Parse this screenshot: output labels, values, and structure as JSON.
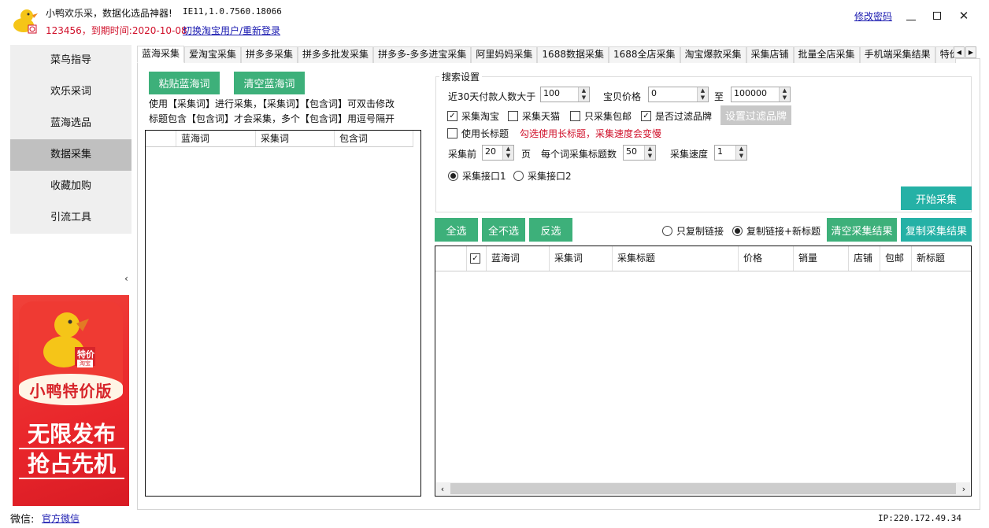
{
  "header": {
    "app_title": "小鸭欢乐采，数据化选品神器!",
    "version": "IE11,1.0.7560.18066",
    "user_info": "123456，到期时间:2020-10-08",
    "switch_user_link": "切换淘宝用户/重新登录",
    "change_password_link": "修改密码",
    "window_controls": {
      "minimize": "—",
      "maximize": "☐",
      "close": "✕"
    }
  },
  "sidebar": {
    "items": [
      {
        "label": "菜鸟指导",
        "active": false
      },
      {
        "label": "欢乐采词",
        "active": false
      },
      {
        "label": "蓝海选品",
        "active": false
      },
      {
        "label": "数据采集",
        "active": true
      },
      {
        "label": "收藏加购",
        "active": false
      },
      {
        "label": "引流工具",
        "active": false
      }
    ],
    "collapse_icon": "‹"
  },
  "banner": {
    "badge_top": "特价",
    "badge_bottom": "淘宝",
    "brand": "小鸭特价版",
    "slogan_line1": "无限发布",
    "slogan_line2": "抢占先机"
  },
  "footer": {
    "wechat_label": "微信:",
    "wechat_link": "官方微信",
    "ip": "IP:220.172.49.34"
  },
  "tabs": {
    "items": [
      "蓝海采集",
      "爱淘宝采集",
      "拼多多采集",
      "拼多多批发采集",
      "拼多多-多多进宝采集",
      "阿里妈妈采集",
      "1688数据采集",
      "1688全店采集",
      "淘宝爆款采集",
      "采集店铺",
      "批量全店采集",
      "手机端采集结果",
      "特价"
    ],
    "active_index": 0,
    "scroll_left": "◀",
    "scroll_right": "▶"
  },
  "left_panel": {
    "paste_button": "粘贴蓝海词",
    "clear_button": "清空蓝海词",
    "hint_line1": "使用【采集词】进行采集，【采集词】【包含词】可双击修改",
    "hint_line2": "标题包含【包含词】才会采集，多个【包含词】用逗号隔开",
    "grid_columns": [
      "",
      "蓝海词",
      "采集词",
      "包含词"
    ]
  },
  "search_settings": {
    "title": "搜索设置",
    "min_buyers_label": "近30天付款人数大于",
    "min_buyers_value": "100",
    "price_label": "宝贝价格",
    "price_min": "0",
    "price_to_label": "至",
    "price_max": "100000",
    "checkboxes": [
      {
        "label": "采集淘宝",
        "checked": true
      },
      {
        "label": "采集天猫",
        "checked": false
      },
      {
        "label": "只采集包邮",
        "checked": false
      },
      {
        "label": "是否过滤品牌",
        "checked": true
      }
    ],
    "filter_brand_button": "设置过滤品牌",
    "long_title": {
      "label": "使用长标题",
      "checked": false
    },
    "long_title_warning": "勾选使用长标题，采集速度会变慢",
    "pages_label": "采集前",
    "pages_value": "20",
    "pages_unit": "页",
    "titles_per_word_label": "每个词采集标题数",
    "titles_per_word_value": "50",
    "speed_label": "采集速度",
    "speed_value": "1",
    "interfaces": [
      {
        "label": "采集接口1",
        "selected": true
      },
      {
        "label": "采集接口2",
        "selected": false
      }
    ],
    "start_button": "开始采集"
  },
  "results": {
    "select_all": "全选",
    "select_none": "全不选",
    "invert": "反选",
    "copy_options": [
      {
        "label": "只复制链接",
        "selected": false
      },
      {
        "label": "复制链接+新标题",
        "selected": true
      }
    ],
    "clear_results": "清空采集结果",
    "copy_results": "复制采集结果",
    "columns": [
      "",
      "☑",
      "蓝海词",
      "采集词",
      "采集标题",
      "价格",
      "销量",
      "店铺",
      "包邮",
      "新标题"
    ]
  },
  "colors": {
    "green_button": "#3db07a",
    "teal_button": "#25b1a6",
    "disabled_button": "#c8c8c8",
    "warning_text": "#d0102a",
    "link": "#1a1ab0",
    "sidebar_active": "#c0c0c0"
  }
}
